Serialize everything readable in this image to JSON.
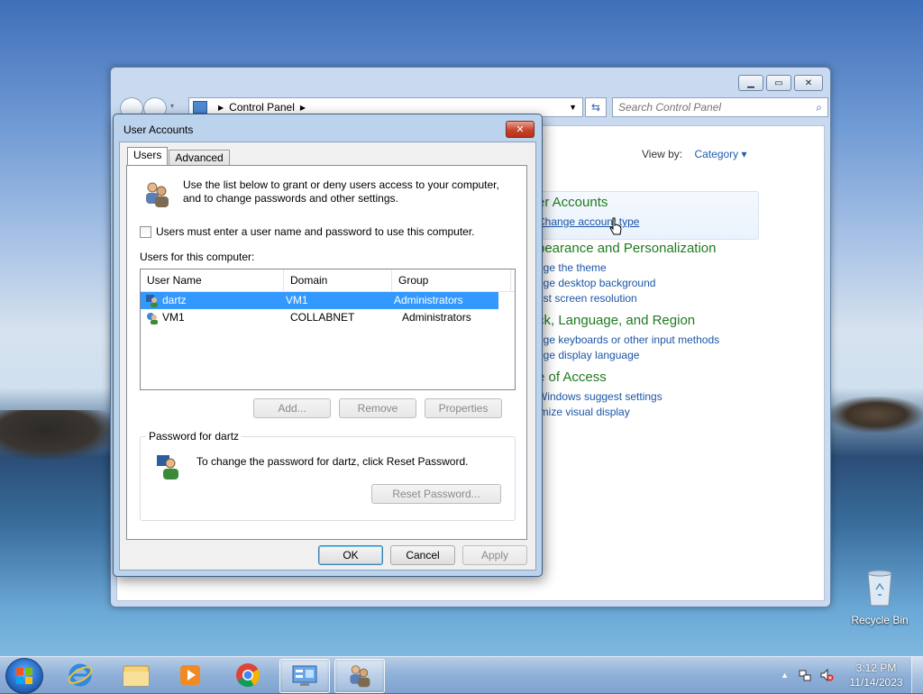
{
  "control_panel": {
    "breadcrumb": "Control Panel",
    "search_placeholder": "Search Control Panel",
    "view_by_label": "View by:",
    "view_by_value": "Category",
    "categories": [
      {
        "title": "er Accounts",
        "links": [
          "Change account type"
        ]
      },
      {
        "title": "pearance and Personalization",
        "links": [
          "nge the theme",
          "nge desktop background",
          "ust screen resolution"
        ]
      },
      {
        "title": "ck, Language, and Region",
        "links": [
          "nge keyboards or other input methods",
          "nge display language"
        ]
      },
      {
        "title": "e of Access",
        "links": [
          "Windows suggest settings",
          "imize visual display"
        ]
      }
    ]
  },
  "dialog": {
    "title": "User Accounts",
    "tabs": [
      "Users",
      "Advanced"
    ],
    "intro": "Use the list below to grant or deny users access to your computer, and to change passwords and other settings.",
    "checkbox_label": "Users must enter a user name and password to use this computer.",
    "users_label": "Users for this computer:",
    "columns": [
      "User Name",
      "Domain",
      "Group"
    ],
    "rows": [
      {
        "user": "dartz",
        "domain": "VM1",
        "group": "Administrators"
      },
      {
        "user": "VM1",
        "domain": "COLLABNET",
        "group": "Administrators"
      }
    ],
    "buttons": {
      "add": "Add...",
      "remove": "Remove",
      "properties": "Properties"
    },
    "password_group": "Password for dartz",
    "password_text": "To change the password for dartz, click Reset Password.",
    "reset_button": "Reset Password...",
    "footer": {
      "ok": "OK",
      "cancel": "Cancel",
      "apply": "Apply"
    }
  },
  "desktop": {
    "recycle_bin": "Recycle Bin"
  },
  "taskbar": {
    "time": "3:12 PM",
    "date": "11/14/2023"
  },
  "colors": {
    "selection": "#3399ff",
    "link": "#1c56a8",
    "category_title": "#1f7a1f"
  }
}
